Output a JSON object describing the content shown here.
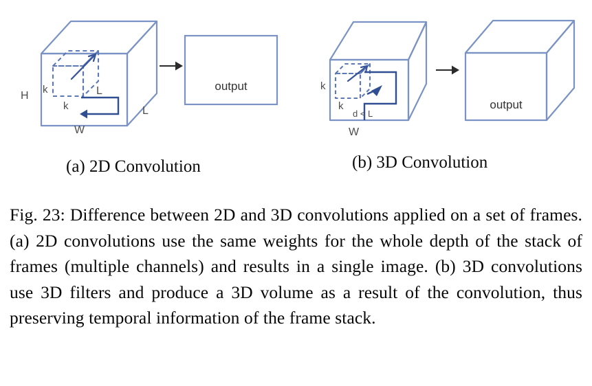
{
  "figure": {
    "label": "Fig. 23",
    "caption": "Fig. 23: Difference between 2D and 3D convolutions applied on a set of frames. (a) 2D convolutions use the same weights for the whole depth of the stack of frames (multiple channels) and results in a single image. (b) 3D convolutions use 3D filters and produce a 3D volume as a result of the convolution, thus preserving temporal information of the frame stack.",
    "subcaptions": [
      {
        "id": "a",
        "text": "(a) 2D Convolution"
      },
      {
        "id": "b",
        "text": "(b) 3D Convolution"
      }
    ]
  },
  "colors": {
    "cube_stroke": "#7a93c4",
    "cube_stroke_dark": "#6a84b9",
    "filter_stroke": "#3a5a9c",
    "arrow": "#2b2b2b",
    "label_text": "#4a4a4a",
    "output_text": "#333333",
    "background": "#ffffff"
  },
  "panel_a": {
    "name": "2D Convolution",
    "input_volume": {
      "type": "cuboid",
      "labels": {
        "height": "H",
        "width": "W",
        "depth": "L",
        "kernel_height": "k",
        "kernel_width": "k",
        "kernel_depth": "L"
      }
    },
    "filter": {
      "type": "dashed-cuboid",
      "note": "kernel spans full depth L"
    },
    "arrow": {
      "direction": "right"
    },
    "output": {
      "shape": "rectangle",
      "label": "output"
    }
  },
  "panel_b": {
    "name": "3D Convolution",
    "input_volume": {
      "type": "cuboid",
      "labels": {
        "width": "W",
        "kernel_height": "k",
        "kernel_width": "k",
        "kernel_depth": "d < L"
      }
    },
    "filter": {
      "type": "dashed-cuboid",
      "note": "kernel depth d smaller than L"
    },
    "arrow": {
      "direction": "right"
    },
    "output": {
      "shape": "cuboid",
      "label": "output"
    }
  }
}
